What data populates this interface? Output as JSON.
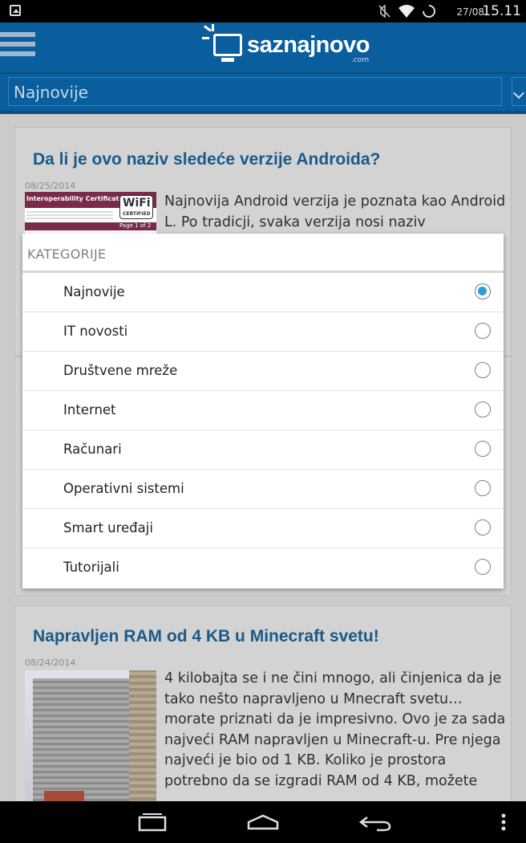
{
  "status_bar": {
    "date": "27/08",
    "time": "15.11",
    "icons": [
      "image-notification-icon",
      "mute-icon",
      "wifi-icon",
      "sync-icon"
    ]
  },
  "app_bar": {
    "logo_text": "saznajnovo",
    "logo_suffix": ".com",
    "menu_icon": "hamburger-icon"
  },
  "category_spinner": {
    "selected": "Najnovije"
  },
  "articles": [
    {
      "title": "Da li je ovo naziv sledeće verzije Androida?",
      "date": "08/25/2014",
      "excerpt": "Najnovija Android verzija je poznata kao Android L. Po tradicji, svaka verzija nosi naziv",
      "thumb_caption_top": "Interoperability Certificate",
      "thumb_badge": "WiFi",
      "thumb_badge_sub": "CERTIFIED",
      "thumb_page": "Page 1 of 2"
    },
    {
      "title": "Napravljen RAM od 4 KB u Minecraft svetu!",
      "date": "08/24/2014",
      "excerpt": "4 kilobajta se i ne čini mnogo, ali činjenica da je tako nešto napravljeno u Mnecraft svetu… morate priznati da je impresivno. Ovo je za sada najveći RAM napravljen u Minecraft-u. Pre njega najveći je bio od 1 KB. Koliko je prostora potrebno da se izgradi RAM od 4 KB, možete"
    }
  ],
  "dialog": {
    "title": "KATEGORIJE",
    "options": [
      {
        "label": "Najnovije",
        "selected": true
      },
      {
        "label": "IT novosti",
        "selected": false
      },
      {
        "label": "Društvene mreže",
        "selected": false
      },
      {
        "label": "Internet",
        "selected": false
      },
      {
        "label": "Računari",
        "selected": false
      },
      {
        "label": "Operativni sistemi",
        "selected": false
      },
      {
        "label": "Smart uređaji",
        "selected": false
      },
      {
        "label": "Tutorijali",
        "selected": false
      }
    ]
  },
  "nav_bar": {
    "buttons": [
      "recent-apps-icon",
      "home-icon",
      "back-icon",
      "overflow-menu-icon"
    ]
  },
  "colors": {
    "app_bar": "#0a5e9e",
    "title_link": "#1a5a8a",
    "radio_checked": "#2a9fd8"
  }
}
